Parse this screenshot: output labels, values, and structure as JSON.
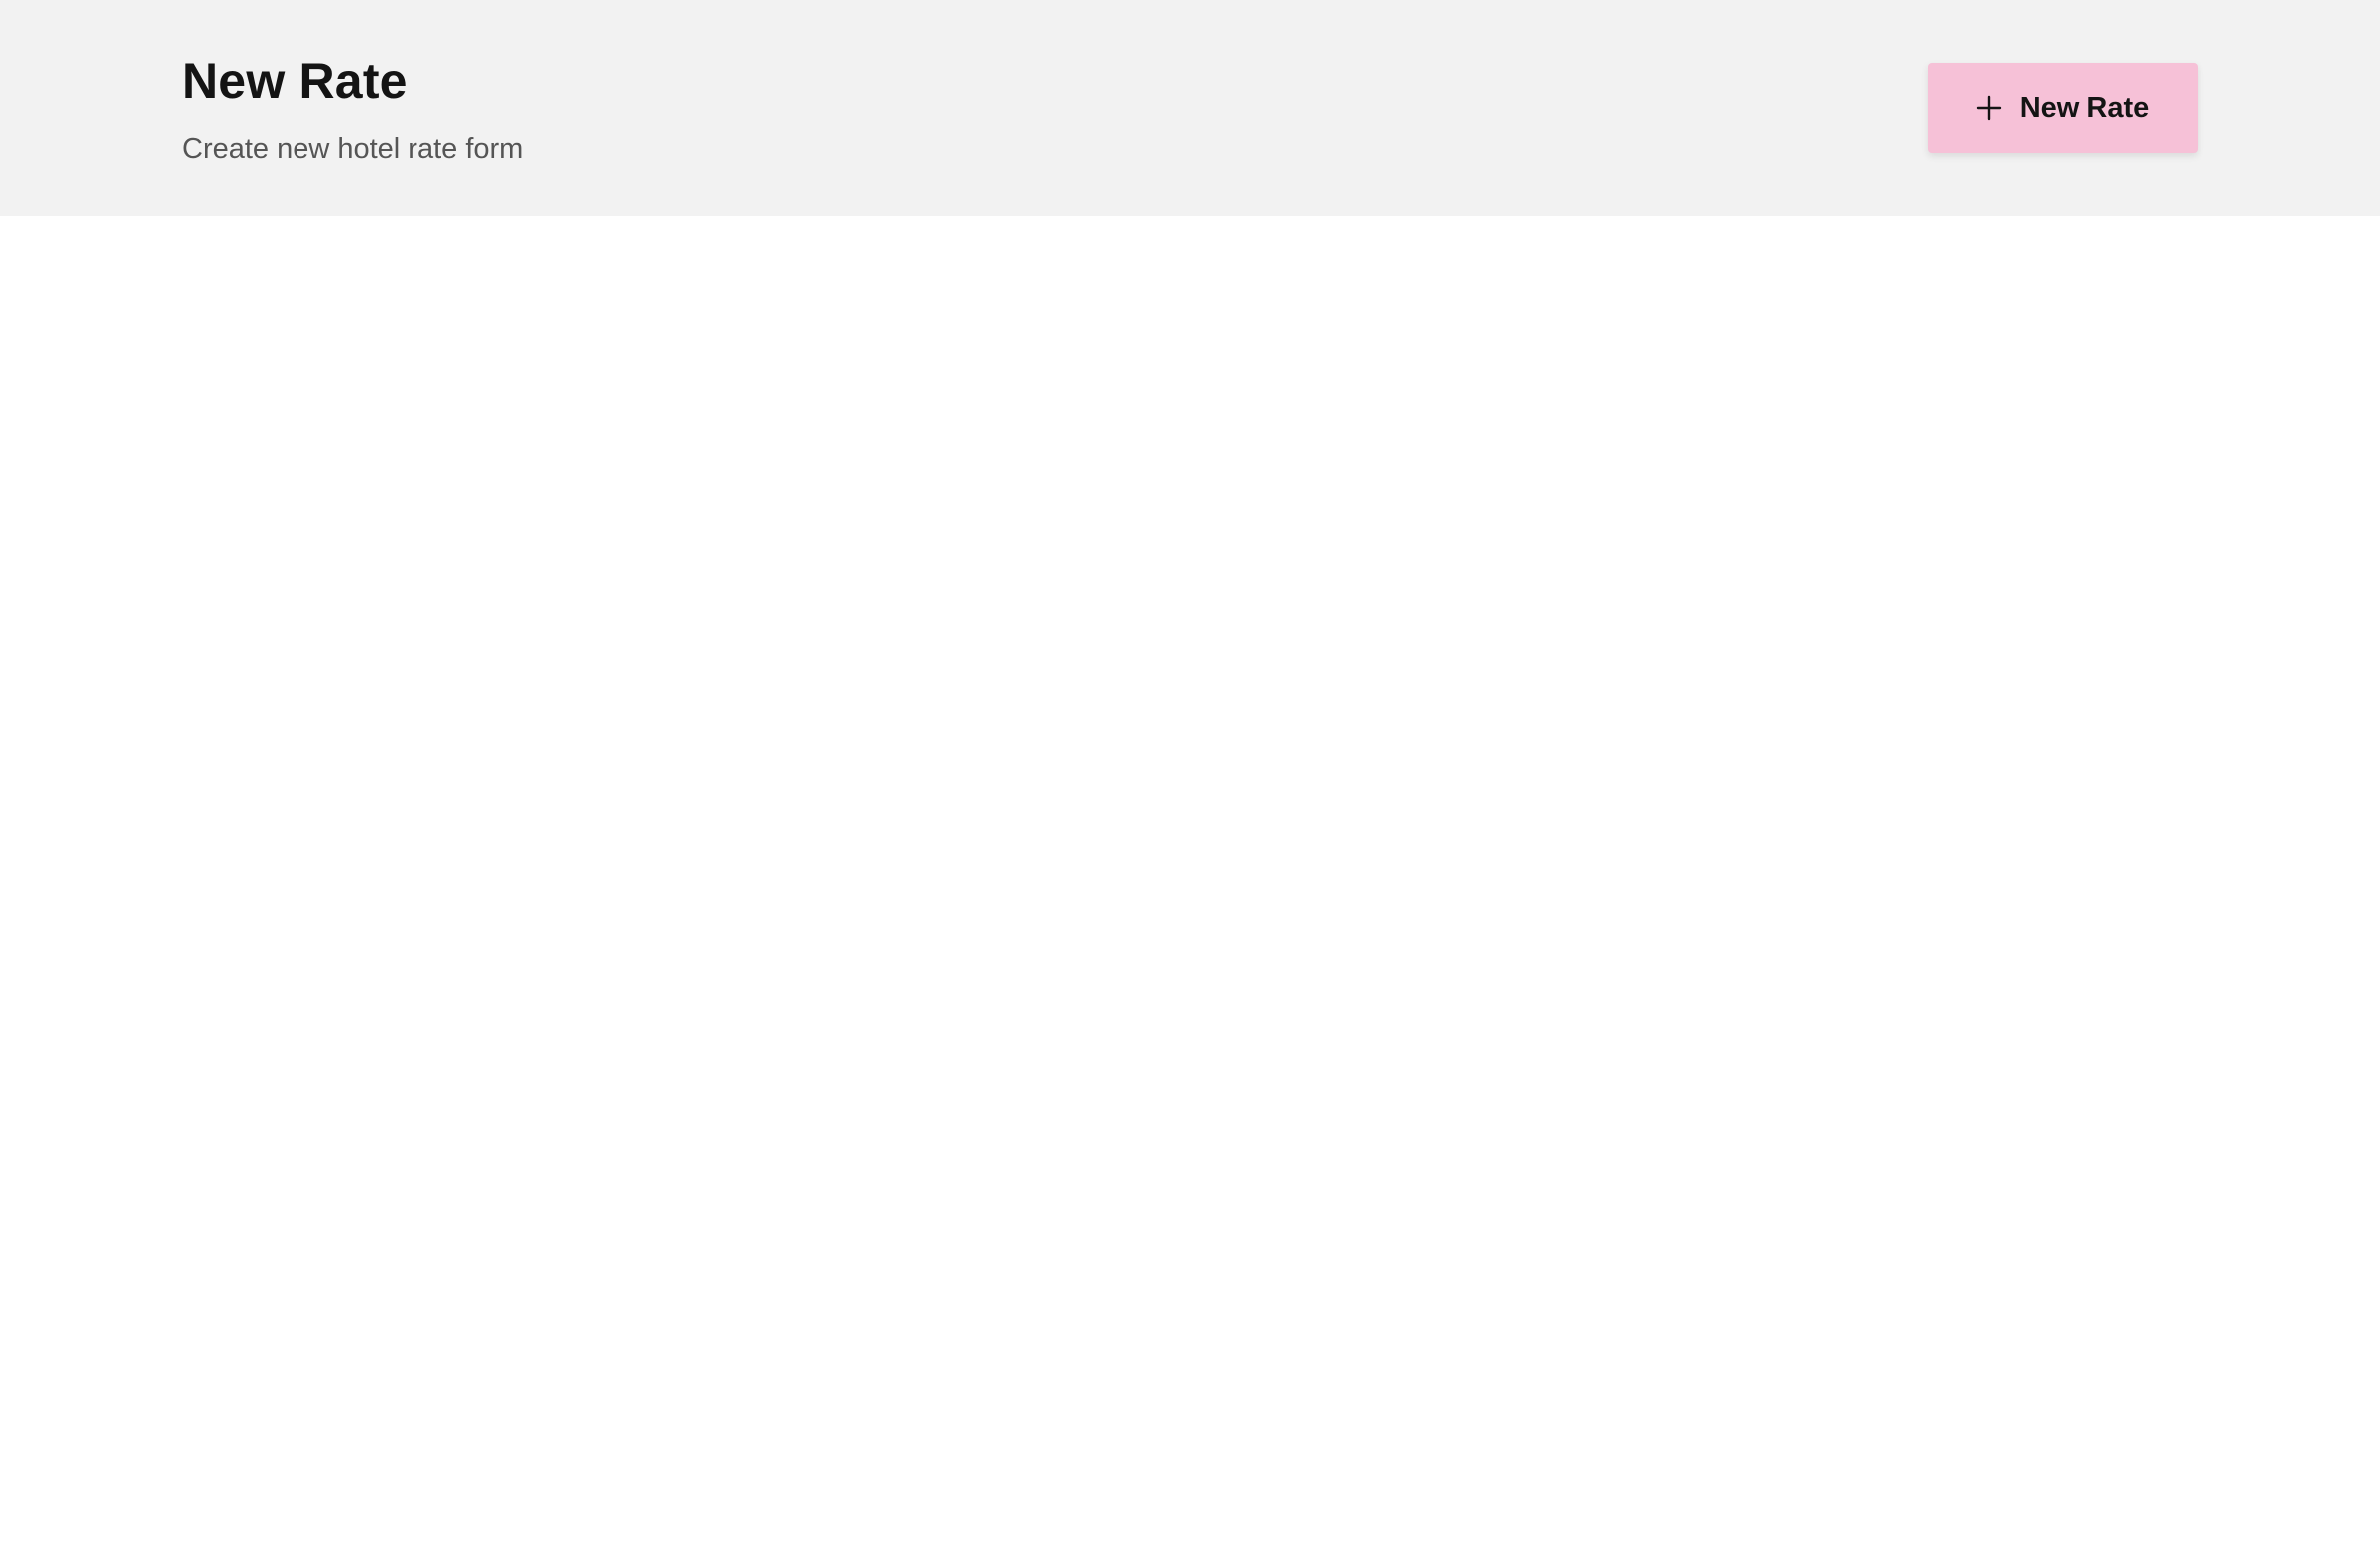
{
  "header": {
    "title": "New Rate",
    "subtitle": "Create new hotel rate form",
    "background_color": "#f2f2f2"
  },
  "actions": {
    "new_rate_button": {
      "label": "New Rate",
      "icon": "plus-icon",
      "color": "#f6c1d7"
    }
  }
}
